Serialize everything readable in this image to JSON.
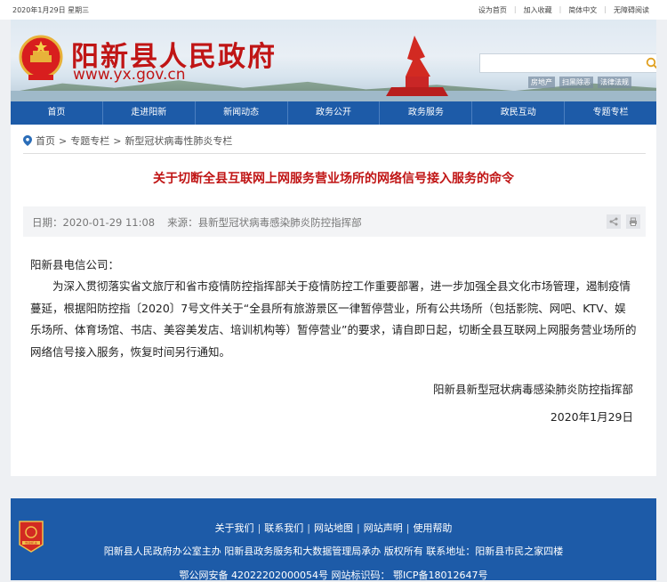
{
  "topbar": {
    "date": "2020年1月29日 星期三",
    "links": [
      "设为首页",
      "加入收藏",
      "简体中文",
      "无障碍阅读"
    ]
  },
  "header": {
    "title": "阳新县人民政府",
    "url": "www.yx.gov.cn",
    "hot_links": [
      "房地产",
      "扫黑除恶",
      "法律法规"
    ],
    "search_placeholder": ""
  },
  "nav": {
    "items": [
      "首页",
      "走进阳新",
      "新闻动态",
      "政务公开",
      "政务服务",
      "政民互动",
      "专题专栏"
    ]
  },
  "breadcrumb": {
    "home": "首页",
    "sep": ">",
    "level1": "专题专栏",
    "level2": "新型冠状病毒性肺炎专栏"
  },
  "article": {
    "title": "关于切断全县互联网上网服务营业场所的网络信号接入服务的命令",
    "date_label": "日期：2020-01-29 11:08",
    "source_label": "来源：县新型冠状病毒感染肺炎防控指挥部",
    "salutation": "阳新县电信公司：",
    "paragraph": "为深入贯彻落实省文旅厅和省市疫情防控指挥部关于疫情防控工作重要部署，进一步加强全县文化市场管理，遏制疫情蔓延，根据阳防控指〔2020〕7号文件关于“全县所有旅游景区一律暂停营业，所有公共场所（包括影院、网吧、KTV、娱乐场所、体育场馆、书店、美容美发店、培训机构等）暂停营业”的要求，请自即日起，切断全县互联网上网服务营业场所的网络信号接入服务，恢复时间另行通知。",
    "signature": "阳新县新型冠状病毒感染肺炎防控指挥部",
    "sign_date": "2020年1月29日"
  },
  "footer": {
    "links": [
      "关于我们",
      "联系我们",
      "网站地图",
      "网站声明",
      "使用帮助"
    ],
    "line2": "阳新县人民政府办公室主办  阳新县政务服务和大数据管理局承办  版权所有  联系地址：阳新县市民之家四楼",
    "line3": "鄂公网安备 42022202000054号  网站标识码：                鄂ICP备18012647号",
    "badge_text": "党政机关"
  },
  "colors": {
    "brand_red": "#c01515",
    "nav_blue": "#1d5ba8"
  },
  "icons": [
    "location-pin-icon",
    "search-icon",
    "share-icon",
    "print-icon",
    "party-badge-icon",
    "police-badge-icon"
  ]
}
